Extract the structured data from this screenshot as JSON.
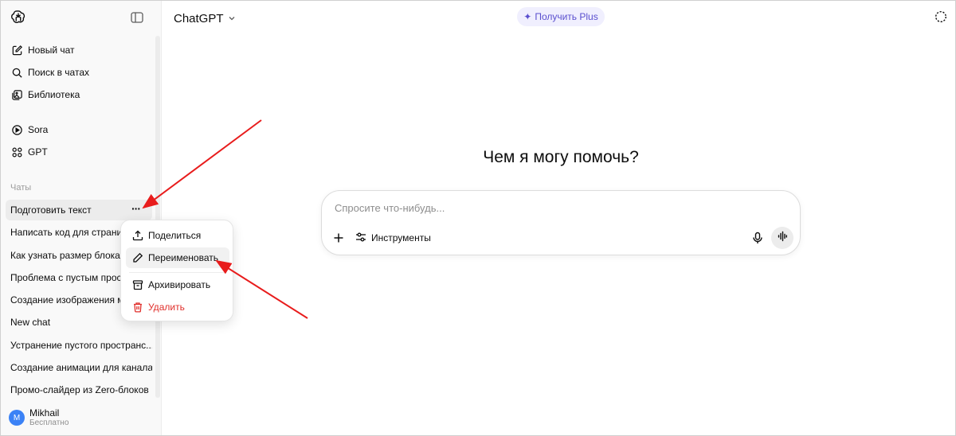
{
  "header": {
    "model_name": "ChatGPT",
    "upgrade_label": "Получить Plus"
  },
  "sidebar": {
    "nav": [
      {
        "label": "Новый чат",
        "icon": "compose-icon"
      },
      {
        "label": "Поиск в чатах",
        "icon": "search-icon"
      },
      {
        "label": "Библиотека",
        "icon": "library-icon"
      },
      {
        "label": "Sora",
        "icon": "play-icon"
      },
      {
        "label": "GPT",
        "icon": "grid-icon"
      }
    ],
    "chats_section_label": "Чаты",
    "chats": [
      "Подготовить текст",
      "Написать код для страницы",
      "Как узнать размер блока",
      "Проблема с пустым пространством",
      "Создание изображения месяца",
      "New chat",
      "Устранение пустого пространс...",
      "Создание анимации для канала",
      "Промо-слайдер из Zero-блоков"
    ],
    "active_chat_index": 0,
    "more_label": "···",
    "user": {
      "initial": "M",
      "name": "Mikhail",
      "plan": "Бесплатно",
      "avatar_color": "#3b82f6"
    }
  },
  "context_menu": {
    "items": [
      {
        "label": "Поделиться",
        "icon": "share-icon"
      },
      {
        "label": "Переименовать",
        "icon": "pencil-icon"
      },
      {
        "label": "Архивировать",
        "icon": "archive-icon"
      },
      {
        "label": "Удалить",
        "icon": "trash-icon",
        "color": "#e02e2a"
      }
    ],
    "highlighted_index": 1
  },
  "main": {
    "greeting": "Чем я могу помочь?",
    "composer": {
      "placeholder": "Спросите что-нибудь...",
      "tools_label": "Инструменты"
    }
  },
  "colors": {
    "accent": "#5a4fcf",
    "annotation_arrow": "#e81c1c",
    "danger": "#e02e2a"
  }
}
